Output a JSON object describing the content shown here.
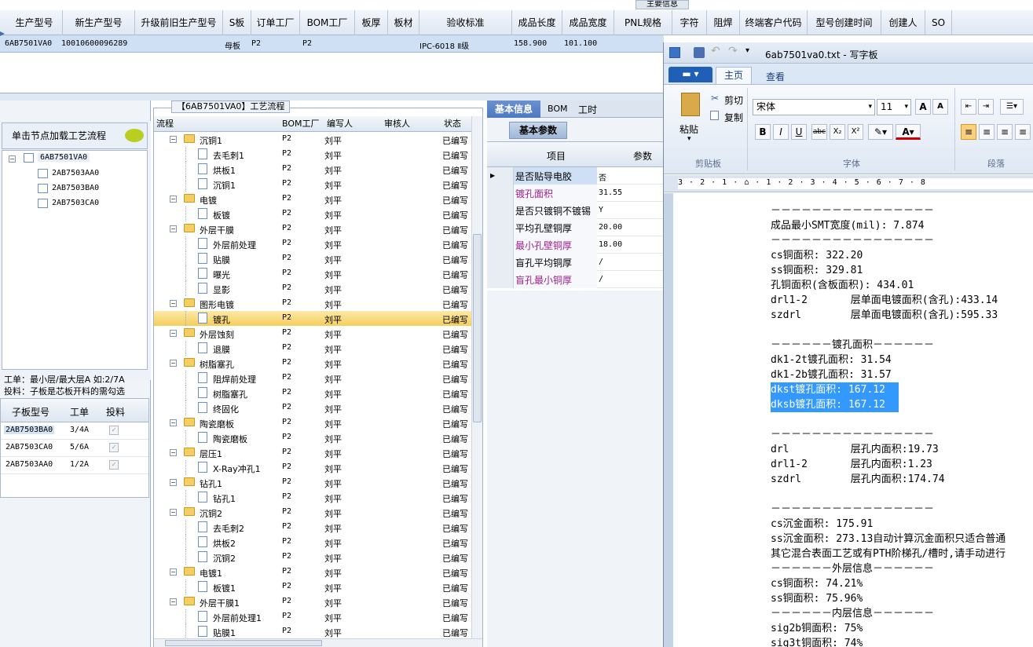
{
  "top_banner": "主要信息",
  "columns": [
    "生产型号",
    "新生产型号",
    "升级前旧生产型号",
    "S板",
    "订单工厂",
    "BOM工厂",
    "板厚",
    "板材",
    "验收标准",
    "成品长度",
    "成品宽度",
    "PNL规格",
    "字符",
    "阻焊",
    "终端客户代码",
    "型号创建时间",
    "创建人",
    "SO"
  ],
  "row": {
    "prod": "6AB7501VA0",
    "newprod": "10010600096289",
    "s": "母板",
    "order": "P2",
    "bom": "P2",
    "std": "IPC-6018 Ⅱ级",
    "len": "158.900",
    "wid": "101.100"
  },
  "left_panel": {
    "load_label": "单击节点加载工艺流程",
    "root": "6AB7501VA0",
    "children": [
      "2AB7503AA0",
      "2AB7503BA0",
      "2AB7503CA0"
    ],
    "note1": "工单：最小层/最大层A 如:2/7A",
    "note2": "投料：子板是芯板开料的需勾选",
    "grid_cols": [
      "子板型号",
      "工单",
      "投料"
    ],
    "grid_rows": [
      {
        "m": "2AB7503BA0",
        "w": "3/4A"
      },
      {
        "m": "2AB7503CA0",
        "w": "5/6A"
      },
      {
        "m": "2AB7503AA0",
        "w": "1/2A"
      }
    ]
  },
  "flow": {
    "title": "【6AB7501VA0】工艺流程",
    "cols": [
      "流程",
      "BOM工厂",
      "编写人",
      "审核人",
      "状态"
    ],
    "rows": [
      {
        "n": "沉铜1",
        "t": "f",
        "f": "P2",
        "w": "刘平",
        "s": "已编写"
      },
      {
        "n": "去毛刺1",
        "t": "d",
        "f": "P2",
        "w": "刘平",
        "s": "已编写"
      },
      {
        "n": "烘板1",
        "t": "d",
        "f": "P2",
        "w": "刘平",
        "s": "已编写"
      },
      {
        "n": "沉铜1",
        "t": "d",
        "f": "P2",
        "w": "刘平",
        "s": "已编写"
      },
      {
        "n": "电镀",
        "t": "f",
        "f": "P2",
        "w": "刘平",
        "s": "已编写"
      },
      {
        "n": "板镀",
        "t": "d",
        "f": "P2",
        "w": "刘平",
        "s": "已编写"
      },
      {
        "n": "外层干膜",
        "t": "f",
        "f": "P2",
        "w": "刘平",
        "s": "已编写"
      },
      {
        "n": "外层前处理",
        "t": "d",
        "f": "P2",
        "w": "刘平",
        "s": "已编写"
      },
      {
        "n": "贴膜",
        "t": "d",
        "f": "P2",
        "w": "刘平",
        "s": "已编写"
      },
      {
        "n": "曝光",
        "t": "d",
        "f": "P2",
        "w": "刘平",
        "s": "已编写"
      },
      {
        "n": "显影",
        "t": "d",
        "f": "P2",
        "w": "刘平",
        "s": "已编写"
      },
      {
        "n": "图形电镀",
        "t": "f",
        "f": "P2",
        "w": "刘平",
        "s": "已编写"
      },
      {
        "n": "镀孔",
        "t": "d",
        "f": "P2",
        "w": "刘平",
        "s": "已编写",
        "sel": true
      },
      {
        "n": "外层蚀刻",
        "t": "f",
        "f": "P2",
        "w": "刘平",
        "s": "已编写"
      },
      {
        "n": "退膜",
        "t": "d",
        "f": "P2",
        "w": "刘平",
        "s": "已编写"
      },
      {
        "n": "树脂塞孔",
        "t": "f",
        "f": "P2",
        "w": "刘平",
        "s": "已编写"
      },
      {
        "n": "阻焊前处理",
        "t": "d",
        "f": "P2",
        "w": "刘平",
        "s": "已编写"
      },
      {
        "n": "树脂塞孔",
        "t": "d",
        "f": "P2",
        "w": "刘平",
        "s": "已编写"
      },
      {
        "n": "终固化",
        "t": "d",
        "f": "P2",
        "w": "刘平",
        "s": "已编写"
      },
      {
        "n": "陶瓷磨板",
        "t": "f",
        "f": "P2",
        "w": "刘平",
        "s": "已编写"
      },
      {
        "n": "陶瓷磨板",
        "t": "d",
        "f": "P2",
        "w": "刘平",
        "s": "已编写"
      },
      {
        "n": "层压1",
        "t": "f",
        "f": "P2",
        "w": "刘平",
        "s": "已编写"
      },
      {
        "n": "X-Ray冲孔1",
        "t": "d",
        "f": "P2",
        "w": "刘平",
        "s": "已编写"
      },
      {
        "n": "钻孔1",
        "t": "f",
        "f": "P2",
        "w": "刘平",
        "s": "已编写"
      },
      {
        "n": "钻孔1",
        "t": "d",
        "f": "P2",
        "w": "刘平",
        "s": "已编写"
      },
      {
        "n": "沉铜2",
        "t": "f",
        "f": "P2",
        "w": "刘平",
        "s": "已编写"
      },
      {
        "n": "去毛刺2",
        "t": "d",
        "f": "P2",
        "w": "刘平",
        "s": "已编写"
      },
      {
        "n": "烘板2",
        "t": "d",
        "f": "P2",
        "w": "刘平",
        "s": "已编写"
      },
      {
        "n": "沉铜2",
        "t": "d",
        "f": "P2",
        "w": "刘平",
        "s": "已编写"
      },
      {
        "n": "电镀1",
        "t": "f",
        "f": "P2",
        "w": "刘平",
        "s": "已编写"
      },
      {
        "n": "板镀1",
        "t": "d",
        "f": "P2",
        "w": "刘平",
        "s": "已编写"
      },
      {
        "n": "外层干膜1",
        "t": "f",
        "f": "P2",
        "w": "刘平",
        "s": "已编写"
      },
      {
        "n": "外层前处理1",
        "t": "d",
        "f": "P2",
        "w": "刘平",
        "s": "已编写"
      },
      {
        "n": "贴膜1",
        "t": "d",
        "f": "P2",
        "w": "刘平",
        "s": "已编写"
      }
    ]
  },
  "info": {
    "tabs": [
      "基本信息",
      "BOM",
      "工时"
    ],
    "subtab": "基本参数",
    "cols": [
      "项目",
      "参数"
    ],
    "rows": [
      {
        "k": "是否贴导电胶",
        "v": "否",
        "c": ""
      },
      {
        "k": "镀孔面积",
        "v": "31.55",
        "c": "#a0208f"
      },
      {
        "k": "是否只镀铜不镀锡",
        "v": "Y",
        "c": ""
      },
      {
        "k": "平均孔壁铜厚",
        "v": "20.00",
        "c": ""
      },
      {
        "k": "最小孔壁铜厚",
        "v": "18.00",
        "c": "#a0208f"
      },
      {
        "k": "盲孔平均铜厚",
        "v": "/",
        "c": ""
      },
      {
        "k": "盲孔最小铜厚",
        "v": "/",
        "c": "#a0208f"
      }
    ]
  },
  "wordpad": {
    "title": "6ab7501va0.txt - 写字板",
    "tabs": [
      "主页",
      "查看"
    ],
    "clipboard": {
      "paste": "粘贴",
      "cut": "剪切",
      "copy": "复制",
      "group": "剪贴板"
    },
    "font": {
      "name": "宋体",
      "size": "11",
      "group": "字体"
    },
    "para_group": "段落",
    "ruler": "3 · 2 · 1 · ⌂ · 1 · 2 · 3 · 4 · 5 · 6 · 7 · 8",
    "lines": [
      {
        "t": "－－－－－－－－－－－－－－－－"
      },
      {
        "t": "成品最小SMT宽度(mil): 7.874"
      },
      {
        "t": "－－－－－－－－－－－－－－－－"
      },
      {
        "t": "cs铜面积: 322.20"
      },
      {
        "t": "ss铜面积: 329.81"
      },
      {
        "t": "孔铜面积(含板面积): 434.01"
      },
      {
        "t": "drl1-2       层单面电镀面积(含孔):433.14"
      },
      {
        "t": "szdrl        层单面电镀面积(含孔):595.33"
      },
      {
        "t": ""
      },
      {
        "t": "－－－－－－镀孔面积－－－－－－"
      },
      {
        "t": "dk1-2t镀孔面积: 31.54"
      },
      {
        "t": "dk1-2b镀孔面积: 31.57"
      },
      {
        "t": "dkst镀孔面积: 167.12",
        "sel": true
      },
      {
        "t": "dksb镀孔面积: 167.12",
        "sel": true
      },
      {
        "t": ""
      },
      {
        "t": "－－－－－－－－－－－－－－－－"
      },
      {
        "t": "drl          层孔内面积:19.73"
      },
      {
        "t": "drl1-2       层孔内面积:1.23"
      },
      {
        "t": "szdrl        层孔内面积:174.74"
      },
      {
        "t": ""
      },
      {
        "t": "－－－－－－－－－－－－－－－－"
      },
      {
        "t": "cs沉金面积: 175.91"
      },
      {
        "t": "ss沉金面积: 273.13自动计算沉金面积只适合普通"
      },
      {
        "t": "其它混合表面工艺或有PTH阶梯孔/槽时,请手动进行"
      },
      {
        "t": "－－－－－－外层信息－－－－－－"
      },
      {
        "t": "cs铜面积: 74.21%"
      },
      {
        "t": "ss铜面积: 75.96%"
      },
      {
        "t": "－－－－－－内层信息－－－－－－"
      },
      {
        "t": "sig2b铜面积: 75%"
      },
      {
        "t": "sig3t铜面积: 74%"
      }
    ]
  },
  "colors": {
    "selection": "#3399ff",
    "ribbon_blue": "#1f5fb5",
    "highlight_row": "#f9d66b",
    "magenta": "#a0208f"
  }
}
